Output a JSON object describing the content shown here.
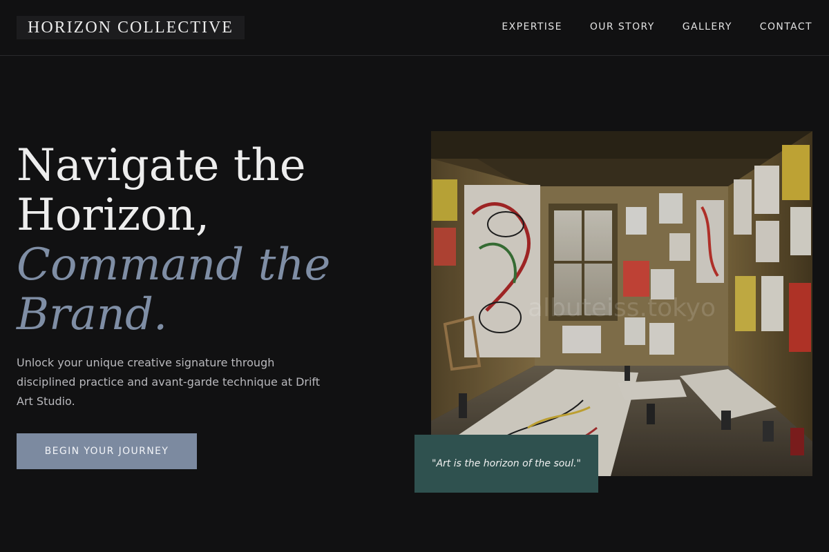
{
  "header": {
    "logo": "HORIZON COLLECTIVE",
    "nav": [
      "EXPERTISE",
      "OUR STORY",
      "GALLERY",
      "CONTACT"
    ]
  },
  "hero": {
    "title_line1": "Navigate the",
    "title_line2": "Horizon,",
    "title_line3": "Command the",
    "title_line4": "Brand.",
    "description": "Unlock your unique creative signature through disciplined practice and avant-garde technique at Drift Art Studio.",
    "cta_label": "BEGIN YOUR JOURNEY"
  },
  "image": {
    "watermark": "albuteiss.tokyo"
  },
  "quote": {
    "text": "\"Art is the horizon of the soul.\""
  },
  "colors": {
    "background": "#111112",
    "accent": "#7f8ea5",
    "button": "#7c8aa0",
    "quote_bg": "#2f514f"
  }
}
